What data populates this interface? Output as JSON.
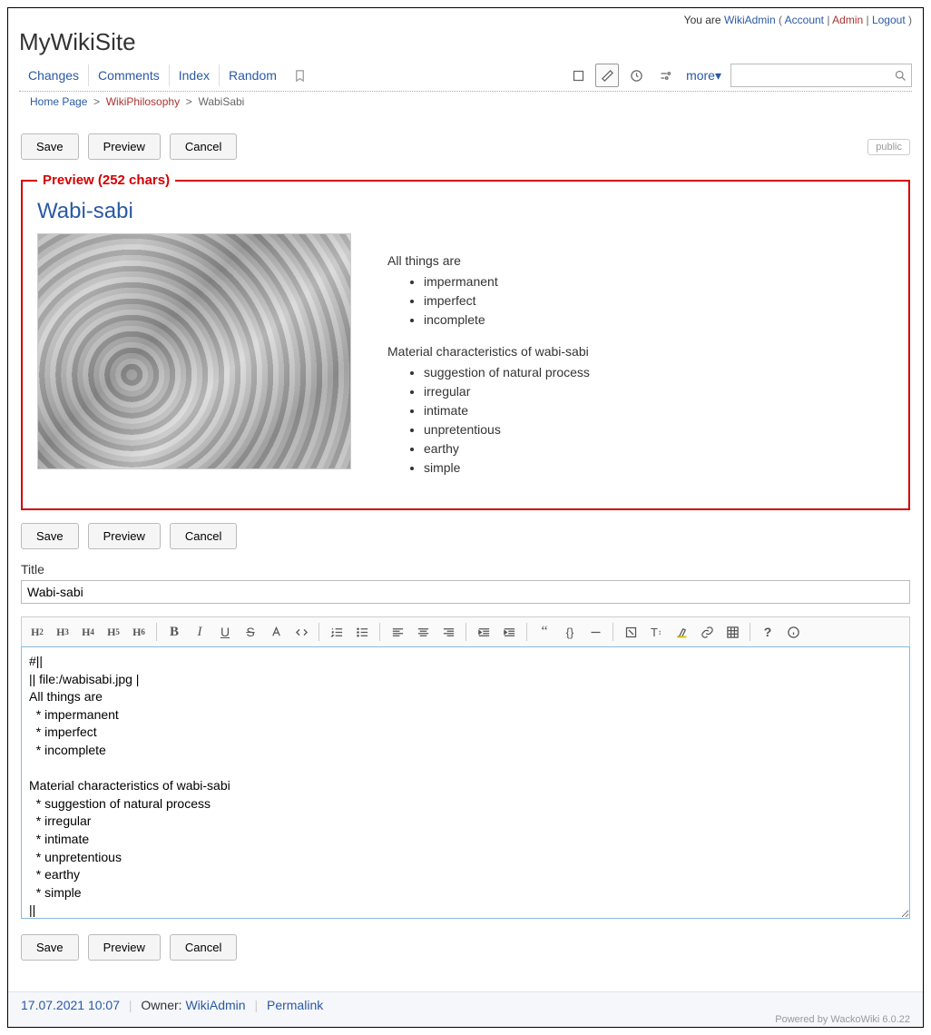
{
  "userbar": {
    "youare": "You are",
    "username": "WikiAdmin",
    "account": "Account",
    "admin": "Admin",
    "logout": "Logout"
  },
  "site_title": "MyWikiSite",
  "nav": {
    "changes": "Changes",
    "comments": "Comments",
    "index": "Index",
    "random": "Random",
    "more": "more▾"
  },
  "breadcrumb": {
    "home": "Home Page",
    "parent": "WikiPhilosophy",
    "current": "WabiSabi"
  },
  "buttons": {
    "save": "Save",
    "preview": "Preview",
    "cancel": "Cancel",
    "public": "public"
  },
  "preview": {
    "legend": "Preview (252 chars)",
    "title": "Wabi-sabi",
    "p1": "All things are",
    "list1": {
      "i0": "impermanent",
      "i1": "imperfect",
      "i2": "incomplete"
    },
    "p2": "Material characteristics of wabi-sabi",
    "list2": {
      "i0": "suggestion of natural process",
      "i1": "irregular",
      "i2": "intimate",
      "i3": "unpretentious",
      "i4": "earthy",
      "i5": "simple"
    }
  },
  "title_field": {
    "label": "Title",
    "value": "Wabi-sabi"
  },
  "toolbar": {
    "h2": "H",
    "h3": "H",
    "h4": "H",
    "h5": "H",
    "h6": "H"
  },
  "editor_content": "#||\n|| file:/wabisabi.jpg |\nAll things are\n  * impermanent\n  * imperfect\n  * incomplete\n\nMaterial characteristics of wabi-sabi\n  * suggestion of natural process\n  * irregular\n  * intimate\n  * unpretentious\n  * earthy\n  * simple\n||\n||#",
  "footer": {
    "date": "17.07.2021 10:07",
    "owner_label": "Owner:",
    "owner": "WikiAdmin",
    "permalink": "Permalink",
    "powered": "Powered by WackoWiki 6.0.22"
  }
}
